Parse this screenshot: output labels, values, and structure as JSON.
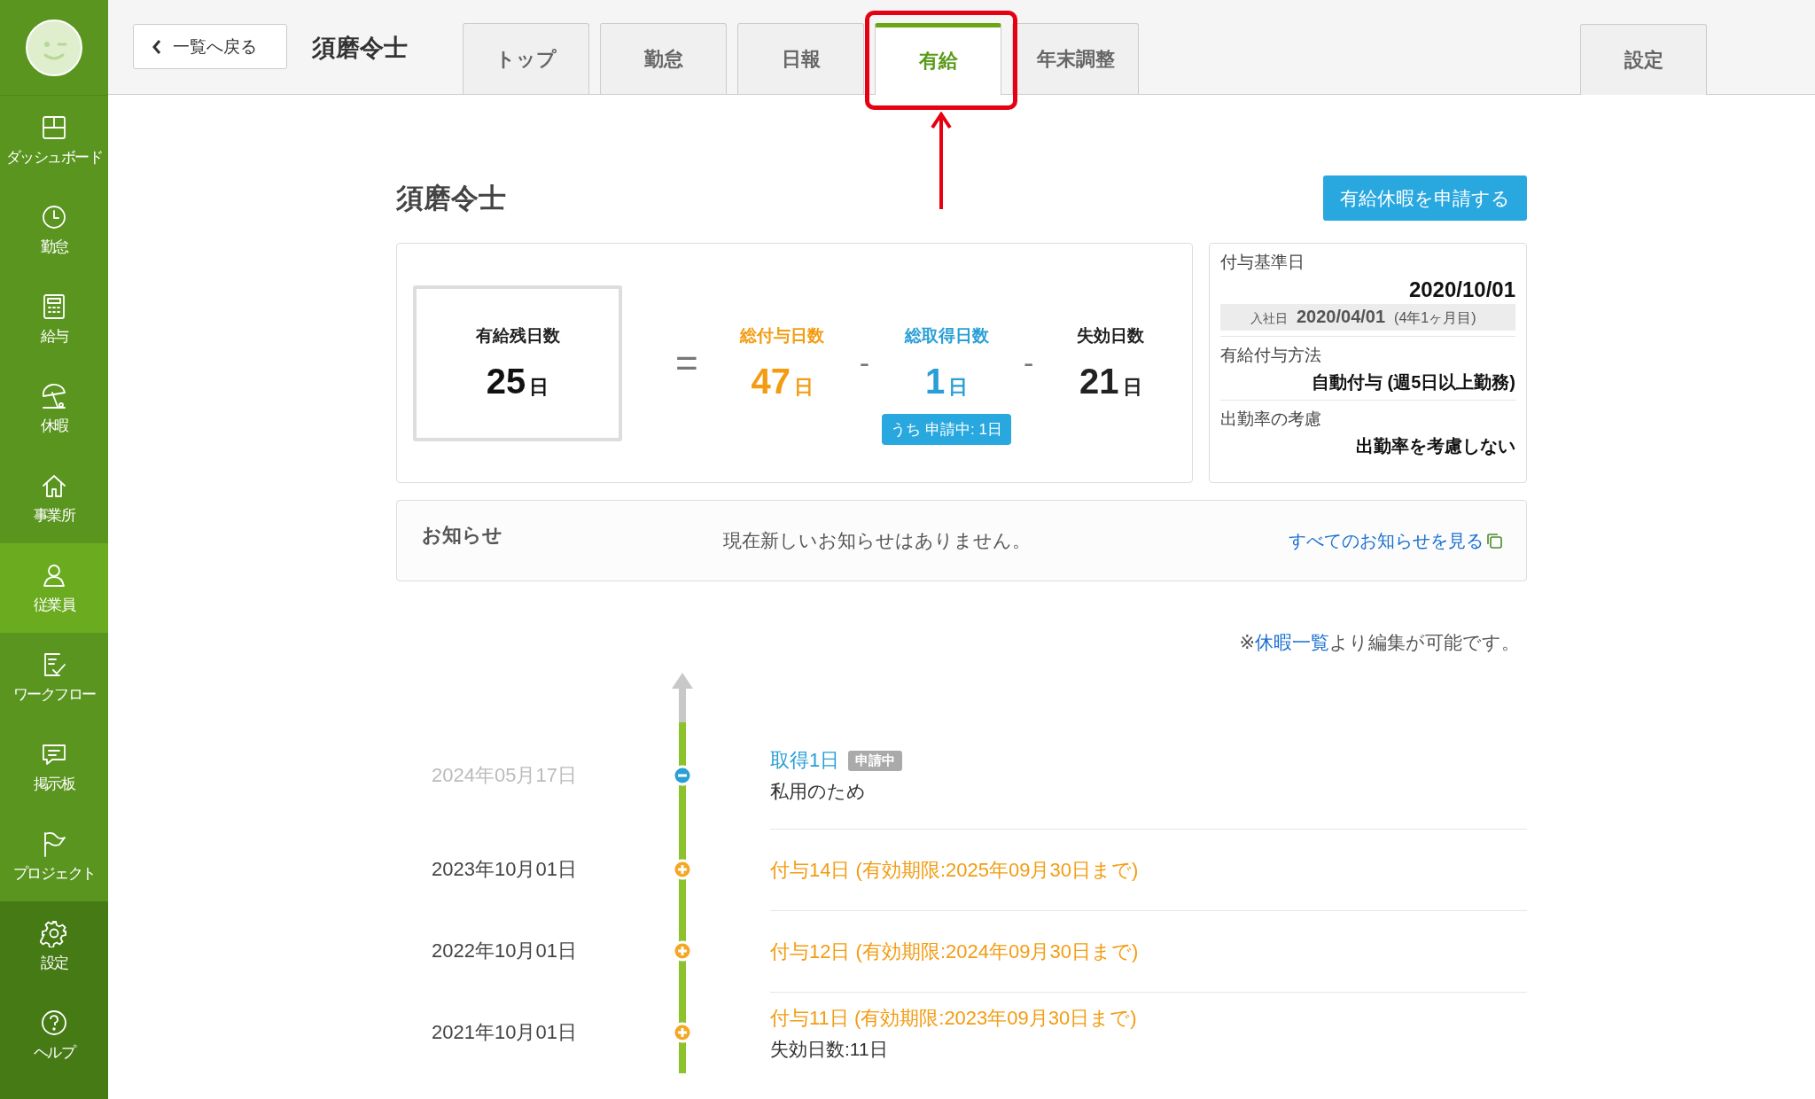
{
  "sidebar": {
    "items": [
      {
        "label": "ダッシュボード",
        "selected": false
      },
      {
        "label": "勤怠",
        "selected": false
      },
      {
        "label": "給与",
        "selected": false
      },
      {
        "label": "休暇",
        "selected": false
      },
      {
        "label": "事業所",
        "selected": false
      },
      {
        "label": "従業員",
        "selected": true
      },
      {
        "label": "ワークフロー",
        "selected": false
      },
      {
        "label": "掲示板",
        "selected": false
      },
      {
        "label": "プロジェクト",
        "selected": false
      }
    ],
    "bottom_items": [
      {
        "label": "設定"
      },
      {
        "label": "ヘルプ"
      }
    ]
  },
  "header": {
    "back_button": "一覧へ戻る",
    "employee_name": "須磨令士",
    "tabs": [
      {
        "label": "トップ",
        "selected": false
      },
      {
        "label": "勤怠",
        "selected": false
      },
      {
        "label": "日報",
        "selected": false
      },
      {
        "label": "有給",
        "selected": true
      },
      {
        "label": "年末調整",
        "selected": false
      }
    ],
    "settings_tab": {
      "label": "設定",
      "selected": false
    }
  },
  "page_title": "須磨令士",
  "apply_button": "有給休暇を申請する",
  "summary": {
    "remaining": {
      "label": "有給残日数",
      "value": "25",
      "unit": "日"
    },
    "equals": "=",
    "terms": [
      {
        "label": "総付与日数",
        "value": "47",
        "unit": "日",
        "color": "#f39c12"
      },
      {
        "operator": "-",
        "label": "総取得日数",
        "value": "1",
        "unit": "日",
        "color": "#2a9fd6",
        "note": "うち 申請中: 1日"
      },
      {
        "operator": "-",
        "label": "失効日数",
        "value": "21",
        "unit": "日",
        "color": "#222222"
      }
    ]
  },
  "info": [
    {
      "label": "付与基準日",
      "value": "2020/10/01",
      "sub": {
        "label": "入社日",
        "value": "2020/04/01",
        "extra": "(4年1ヶ月目)"
      }
    },
    {
      "label": "有給付与方法",
      "value": "自動付与 (週5日以上勤務)"
    },
    {
      "label": "出勤率の考慮",
      "value": "出勤率を考慮しない"
    }
  ],
  "notice": {
    "title": "お知らせ",
    "message": "現在新しいお知らせはありません。",
    "link": "すべてのお知らせを見る"
  },
  "edit_note": {
    "prefix": "※",
    "link": "休暇一覧",
    "suffix": "より編集が可能です。"
  },
  "timeline": [
    {
      "date": "2024年05月17日",
      "kind": "take",
      "title": "取得1日",
      "badge": "申請中",
      "note": "私用のため"
    },
    {
      "date": "2023年10月01日",
      "kind": "grant",
      "title": "付与14日 (有効期限:2025年09月30日まで)"
    },
    {
      "date": "2022年10月01日",
      "kind": "grant",
      "title": "付与12日 (有効期限:2024年09月30日まで)"
    },
    {
      "date": "2021年10月01日",
      "kind": "grant",
      "title": "付与11日 (有効期限:2023年09月30日まで)",
      "note": "失効日数:11日"
    }
  ]
}
